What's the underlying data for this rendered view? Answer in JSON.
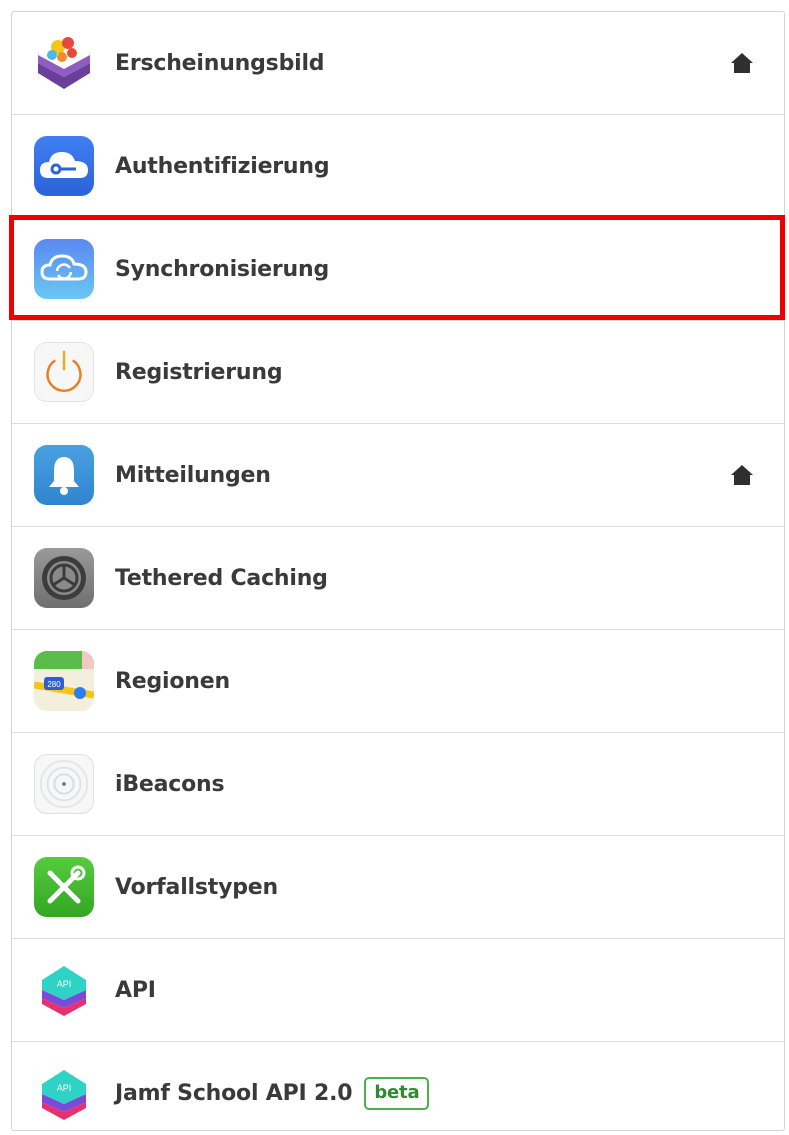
{
  "settings_menu": {
    "items": [
      {
        "label": "Erscheinungsbild",
        "icon": "appearance-icon",
        "home": true
      },
      {
        "label": "Authentifizierung",
        "icon": "cloud-key-icon",
        "home": false
      },
      {
        "label": "Synchronisierung",
        "icon": "cloud-sync-icon",
        "home": false
      },
      {
        "label": "Registrierung",
        "icon": "power-icon",
        "home": false
      },
      {
        "label": "Mitteilungen",
        "icon": "bell-icon",
        "home": true
      },
      {
        "label": "Tethered Caching",
        "icon": "settings-gear-icon",
        "home": false
      },
      {
        "label": "Regionen",
        "icon": "maps-icon",
        "home": false
      },
      {
        "label": "iBeacons",
        "icon": "ibeacon-icon",
        "home": false
      },
      {
        "label": "Vorfallstypen",
        "icon": "tools-icon",
        "home": false
      },
      {
        "label": "API",
        "icon": "api-stack-icon",
        "home": false
      },
      {
        "label": "Jamf School API 2.0",
        "icon": "api-stack-icon",
        "home": false,
        "badge": "beta"
      }
    ],
    "highlighted_item": "Synchronisierung"
  },
  "colors": {
    "highlight": "#ee0000",
    "badge": "#4caf50",
    "border": "#d4d4d4"
  }
}
